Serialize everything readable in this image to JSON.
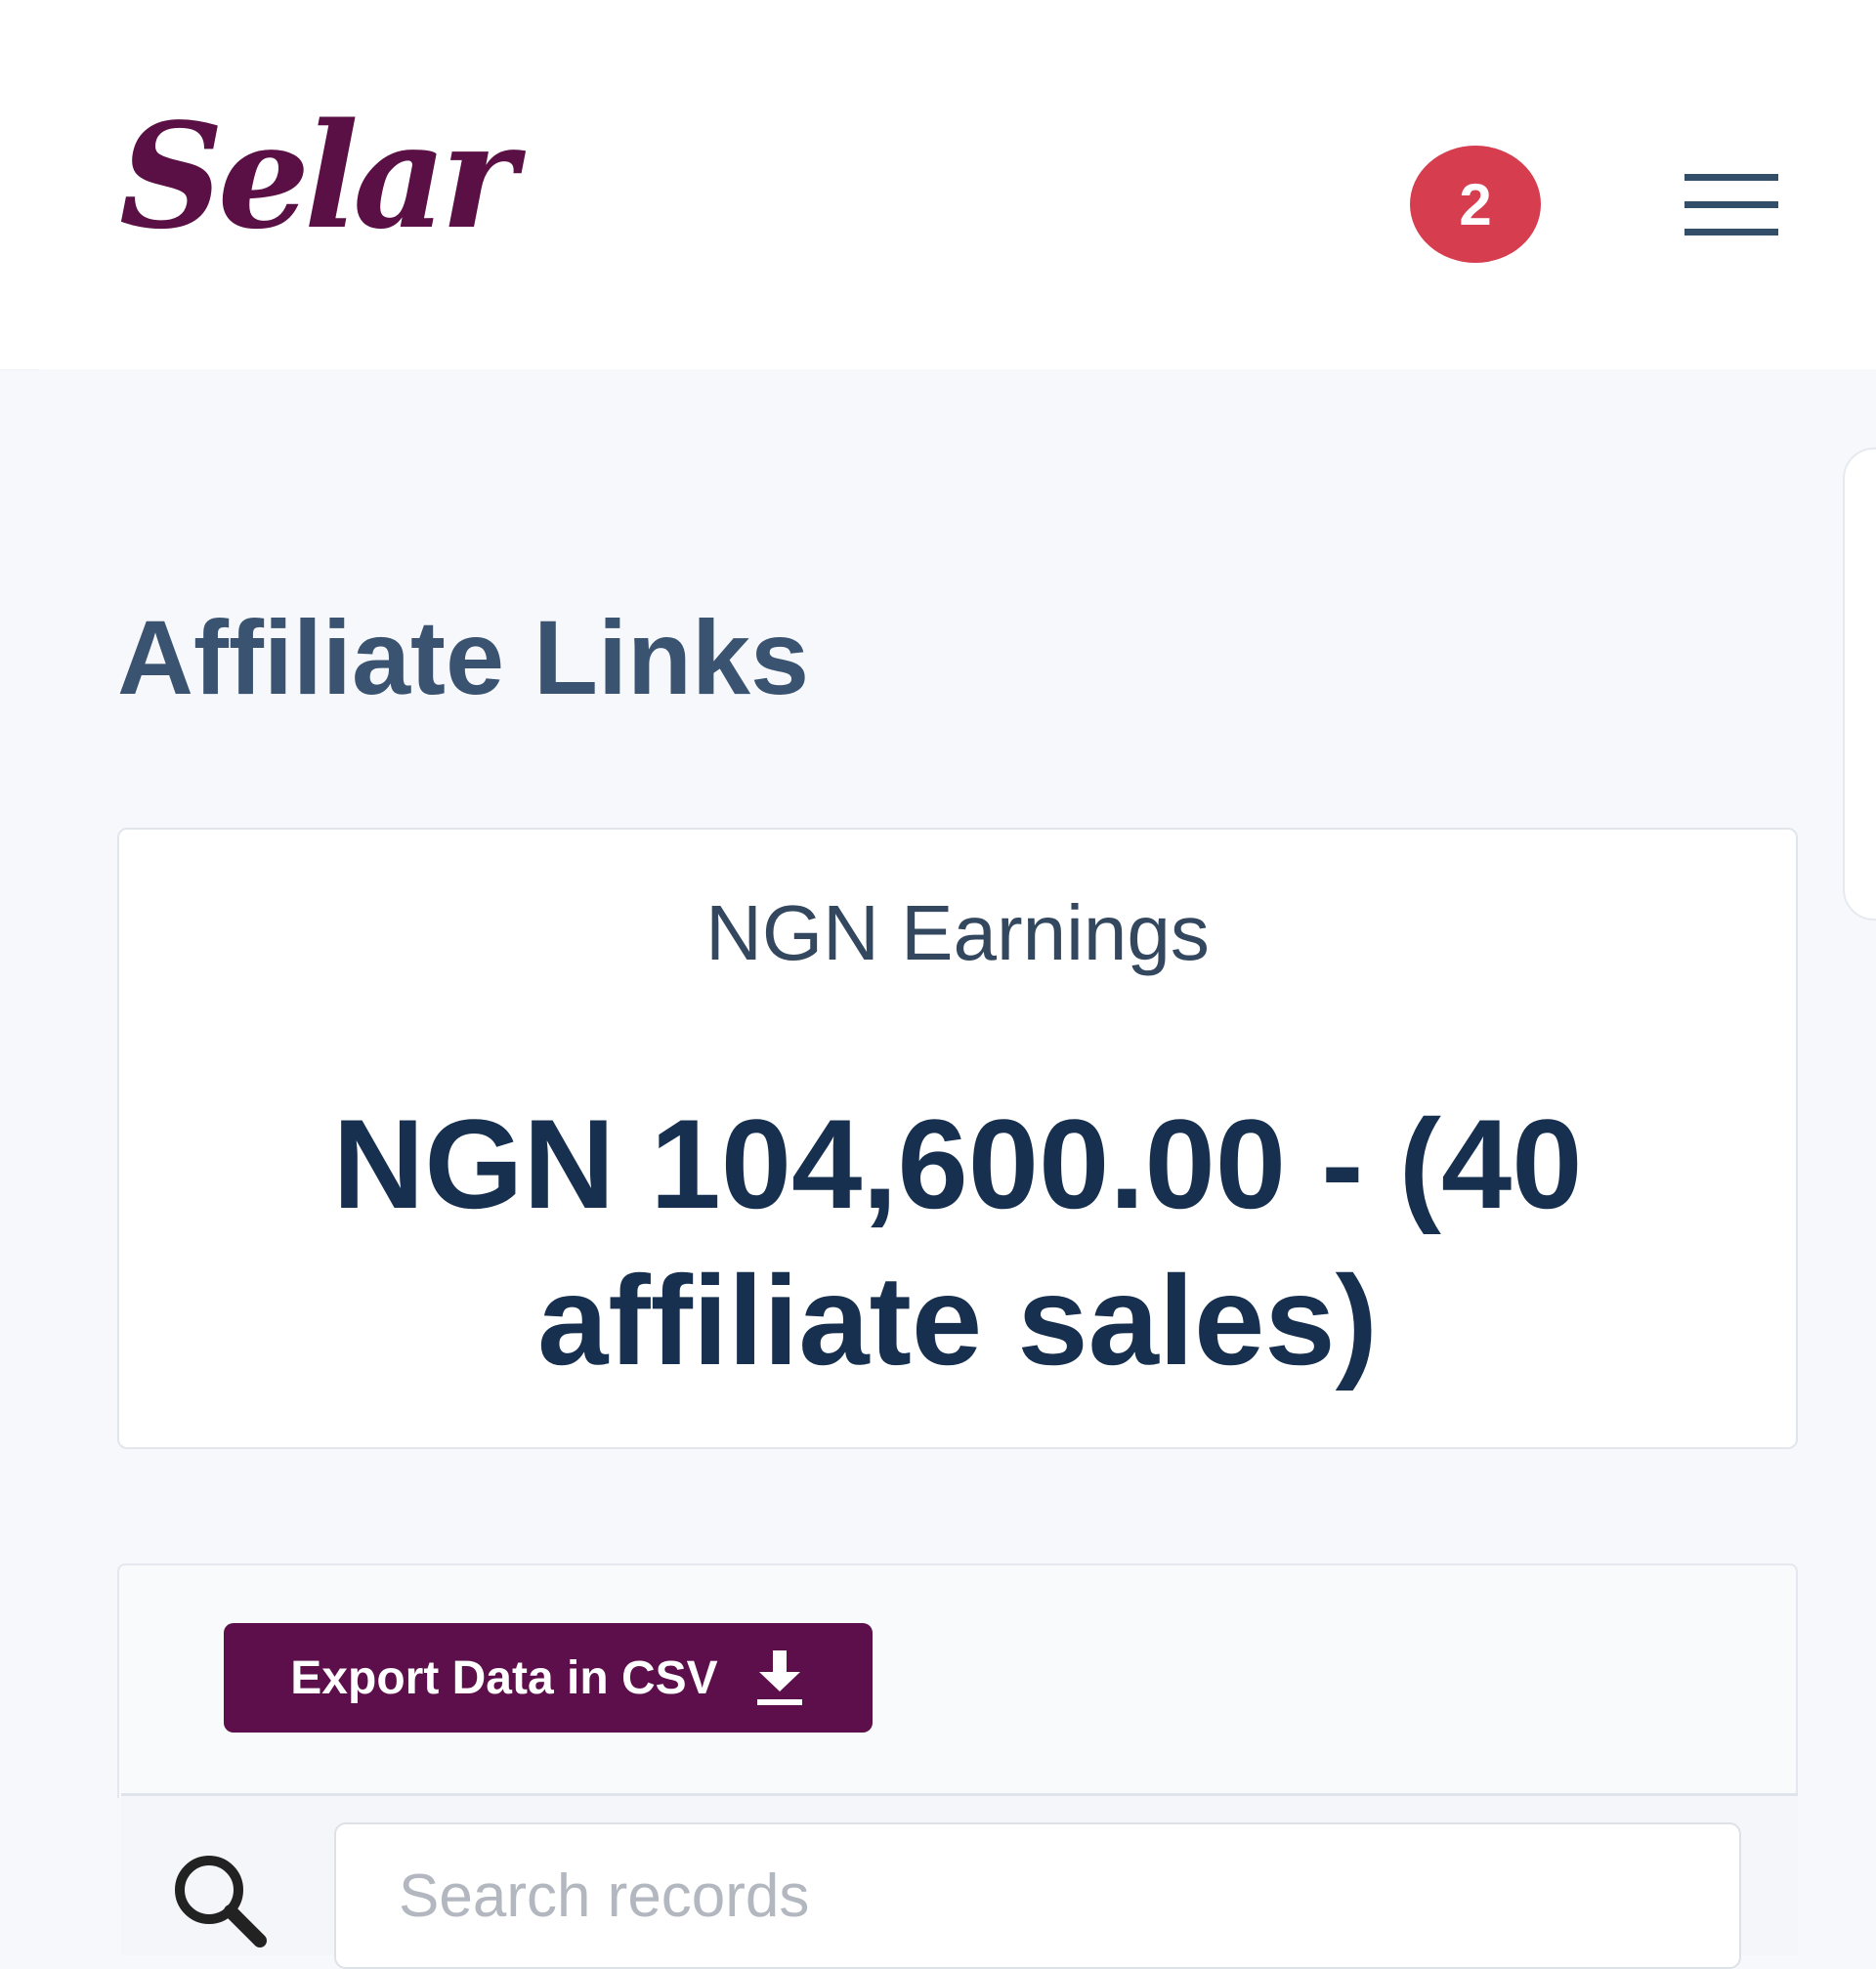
{
  "header": {
    "logo_text": "Selar",
    "notification_count": "2"
  },
  "page": {
    "title": "Affiliate Links"
  },
  "earnings": {
    "label": "NGN Earnings",
    "amount_text": "NGN 104,600.00 - (40 affiliate sales)"
  },
  "export": {
    "button_label": "Export Data in CSV"
  },
  "search": {
    "placeholder": "Search records"
  },
  "colors": {
    "brand": "#5d0f4b",
    "badge": "#d63d4e",
    "heading": "#3a5370",
    "amount": "#17304f"
  },
  "icons": {
    "menu": "hamburger-menu-icon",
    "download": "download-icon",
    "search": "search-icon"
  }
}
